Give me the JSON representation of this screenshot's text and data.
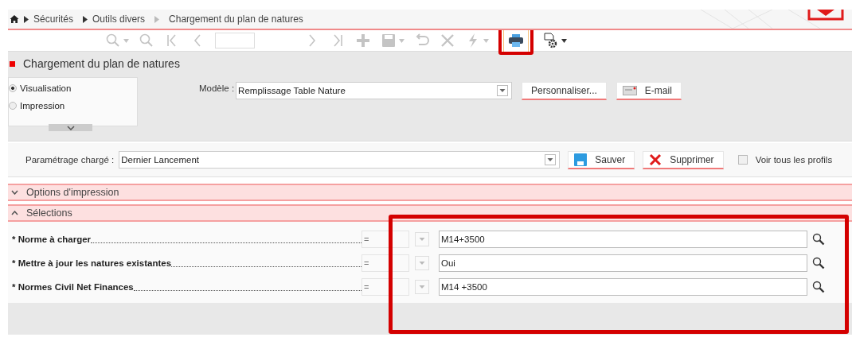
{
  "breadcrumb": [
    {
      "label": "Sécurités"
    },
    {
      "label": "Outils divers"
    },
    {
      "label": "Chargement du plan de natures"
    }
  ],
  "toolbar": [
    {
      "kind": "search-menu",
      "disabled": true,
      "highlighted": false
    },
    {
      "kind": "search",
      "disabled": true,
      "highlighted": false
    },
    {
      "kind": "first",
      "disabled": true,
      "highlighted": false
    },
    {
      "kind": "prev",
      "disabled": true,
      "highlighted": false
    },
    {
      "kind": "page",
      "disabled": true,
      "highlighted": false
    },
    {
      "kind": "next",
      "disabled": true,
      "highlighted": false
    },
    {
      "kind": "last",
      "disabled": true,
      "highlighted": false
    },
    {
      "kind": "add",
      "disabled": true,
      "highlighted": false
    },
    {
      "kind": "save-menu",
      "disabled": true,
      "highlighted": false
    },
    {
      "kind": "undo",
      "disabled": true,
      "highlighted": false
    },
    {
      "kind": "delete",
      "disabled": true,
      "highlighted": false
    },
    {
      "kind": "run-menu",
      "disabled": true,
      "highlighted": false
    },
    {
      "kind": "print",
      "disabled": false,
      "highlighted": true
    },
    {
      "kind": "settings-menu",
      "disabled": false,
      "highlighted": false
    }
  ],
  "page_title": "Chargement du plan de natures",
  "output_modes": [
    {
      "label": "Visualisation",
      "selected": true
    },
    {
      "label": "Impression",
      "selected": false
    }
  ],
  "model": {
    "label": "Modèle :",
    "value": "Remplissage Table Nature",
    "buttons": [
      {
        "kind": "plain",
        "label": "Personnaliser..."
      },
      {
        "kind": "email",
        "label": "E-mail"
      }
    ]
  },
  "settings": {
    "label": "Paramétrage chargé :",
    "value": "Dernier Lancement",
    "buttons": [
      {
        "kind": "save",
        "label": "Sauver"
      },
      {
        "kind": "delete",
        "label": "Supprimer"
      }
    ],
    "all_profiles": {
      "label": "Voir tous les profils",
      "checked": false
    }
  },
  "sections": [
    {
      "label": "Options d'impression",
      "expanded": false
    },
    {
      "label": "Sélections",
      "expanded": true
    }
  ],
  "selections": {
    "highlighted": true,
    "rows": [
      {
        "label": "* Norme à charger",
        "operator": "=",
        "value": "M14+3500"
      },
      {
        "label": "* Mettre à jour les natures existantes",
        "operator": "=",
        "value": "Oui"
      },
      {
        "label": "* Normes Civil Net Finances",
        "operator": "=",
        "value": "M14 +3500"
      }
    ]
  }
}
